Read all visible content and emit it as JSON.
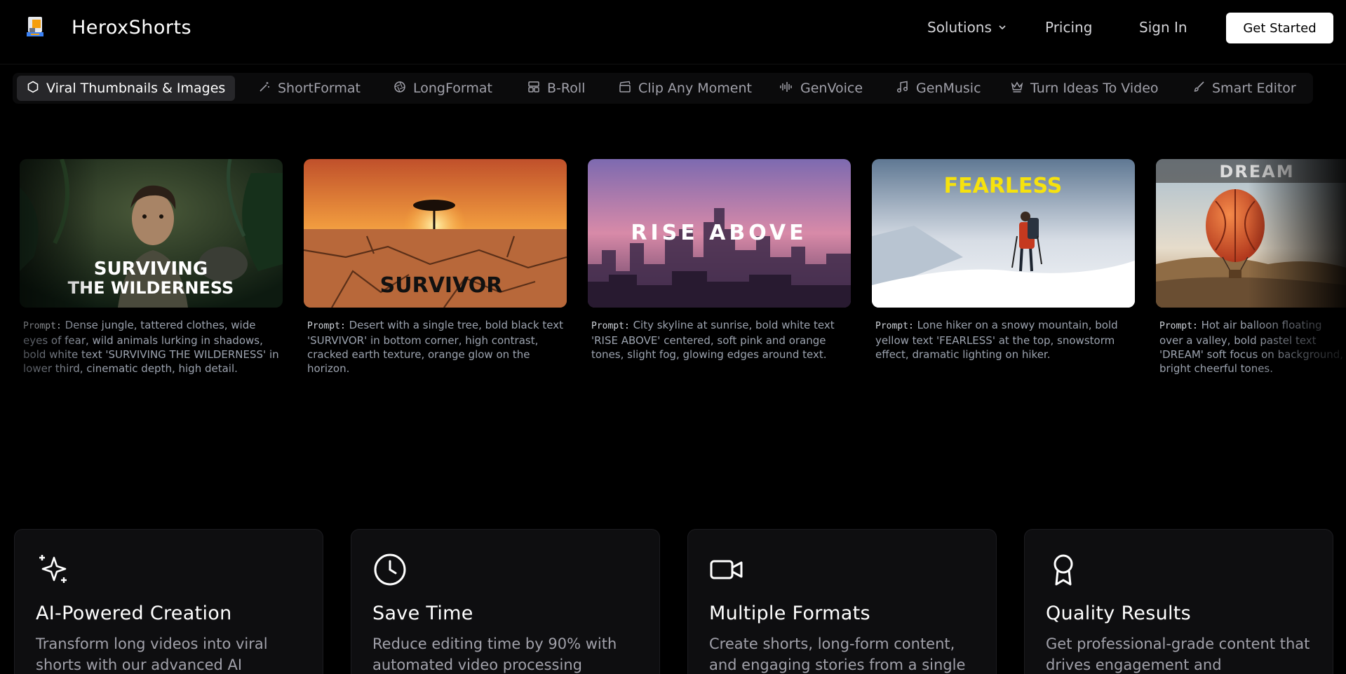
{
  "header": {
    "brand": "HeroxShorts",
    "nav": {
      "solutions": "Solutions",
      "pricing": "Pricing",
      "sign_in": "Sign In",
      "get_started": "Get Started"
    }
  },
  "tabs": [
    {
      "label": "Viral Thumbnails & Images",
      "icon": "hexagon-icon",
      "active": true
    },
    {
      "label": "ShortFormat",
      "icon": "magic-wand-icon"
    },
    {
      "label": "LongFormat",
      "icon": "aperture-icon"
    },
    {
      "label": "B-Roll",
      "icon": "layout-icon"
    },
    {
      "label": "Clip Any Moment",
      "icon": "clapperboard-icon"
    },
    {
      "label": "GenVoice",
      "icon": "audio-waveform-icon"
    },
    {
      "label": "GenMusic",
      "icon": "music-note-icon"
    },
    {
      "label": "Turn Ideas To Video",
      "icon": "crown-icon"
    },
    {
      "label": "Smart Editor",
      "icon": "brush-icon"
    }
  ],
  "gallery": {
    "prompt_label": "Prompt:",
    "cards": [
      {
        "overlay": "SURVIVING THE WILDERNESS",
        "overlay_line1": "SURVIVING",
        "overlay_line2": "THE WILDERNESS",
        "prompt": "Dense jungle, tattered clothes, wide eyes of fear, wild animals lurking in shadows, bold white text 'SURVIVING THE WILDERNESS' in lower third, cinematic depth, high detail."
      },
      {
        "overlay": "SURVIVOR",
        "prompt": "Desert with a single tree, bold black text 'SURVIVOR' in bottom corner, high contrast, cracked earth texture, orange glow on the horizon."
      },
      {
        "overlay": "RISE ABOVE",
        "prompt": "City skyline at sunrise, bold white text 'RISE ABOVE' centered, soft pink and orange tones, slight fog, glowing edges around text."
      },
      {
        "overlay": "FEARLESS",
        "prompt": "Lone hiker on a snowy mountain, bold yellow text 'FEARLESS' at the top, snowstorm effect, dramatic lighting on hiker."
      },
      {
        "overlay": "DREAM",
        "prompt": "Hot air balloon floating over a valley, bold pastel text 'DREAM' soft focus on background, bright cheerful tones."
      }
    ]
  },
  "features": [
    {
      "title": "AI-Powered Creation",
      "description": "Transform long videos into viral shorts with our advanced AI",
      "icon": "sparkles-icon"
    },
    {
      "title": "Save Time",
      "description": "Reduce editing time by 90% with automated video processing",
      "icon": "clock-icon"
    },
    {
      "title": "Multiple Formats",
      "description": "Create shorts, long-form content, and engaging stories from a single",
      "icon": "video-camera-icon"
    },
    {
      "title": "Quality Results",
      "description": "Get professional-grade content that drives engagement and",
      "icon": "award-icon"
    }
  ],
  "colors": {
    "background": "#000000",
    "tab_active": "#27272a",
    "card_bg": "#0e0e10",
    "muted_text": "#a1a1aa",
    "fearless_yellow": "#f6e20e"
  }
}
